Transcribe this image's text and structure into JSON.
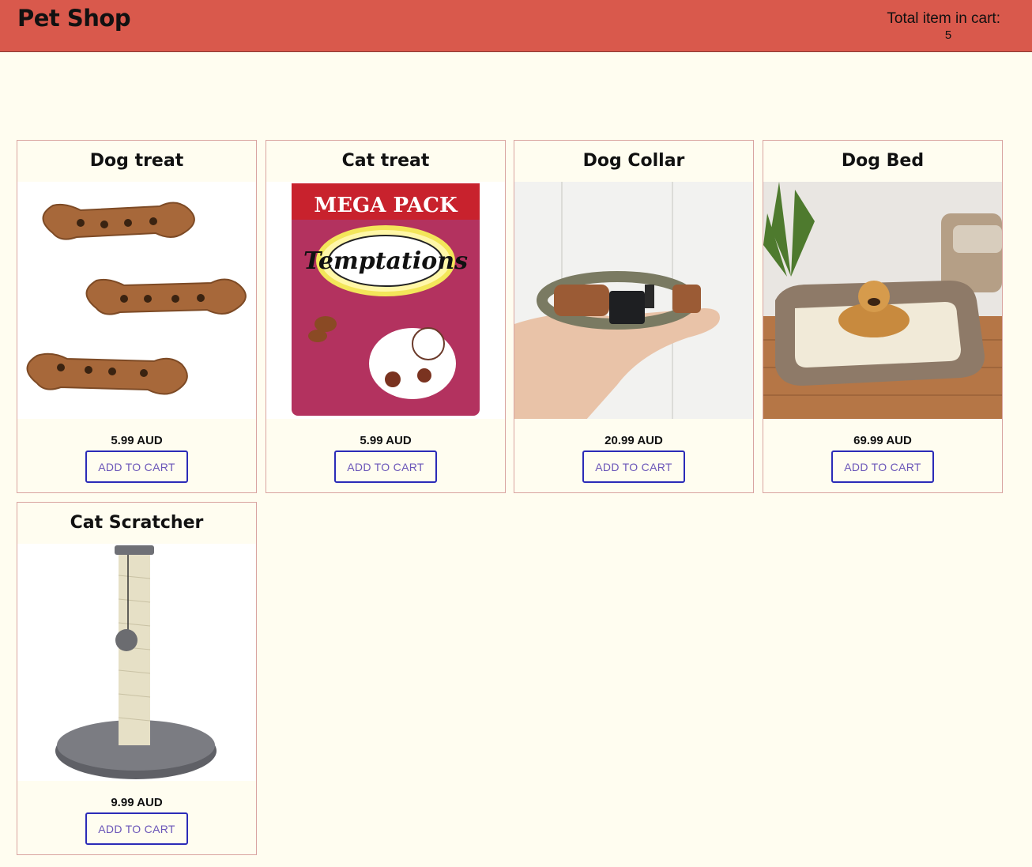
{
  "header": {
    "brand": "Pet Shop",
    "cart_label": "Total item in cart:",
    "cart_count": "5"
  },
  "colors": {
    "header_bg": "#d9594c",
    "page_bg": "#fffdf0",
    "card_border": "#d9a4a0",
    "button_border": "#2b2bb8",
    "button_text": "#6a55b8"
  },
  "products": [
    {
      "title": "Dog treat",
      "price": "5.99 AUD",
      "button": "ADD TO CART",
      "image": "dog-bone-biscuits"
    },
    {
      "title": "Cat treat",
      "price": "5.99 AUD",
      "button": "ADD TO CART",
      "image": "temptations-mega-pack"
    },
    {
      "title": "Dog Collar",
      "price": "20.99 AUD",
      "button": "ADD TO CART",
      "image": "dog-collar-in-hand"
    },
    {
      "title": "Dog Bed",
      "price": "69.99 AUD",
      "button": "ADD TO CART",
      "image": "golden-retriever-on-bed"
    },
    {
      "title": "Cat Scratcher",
      "price": "9.99 AUD",
      "button": "ADD TO CART",
      "image": "cat-scratching-post"
    }
  ],
  "images": {
    "cat_treat_banner": "MEGA PACK",
    "cat_treat_brand": "Temptations"
  }
}
